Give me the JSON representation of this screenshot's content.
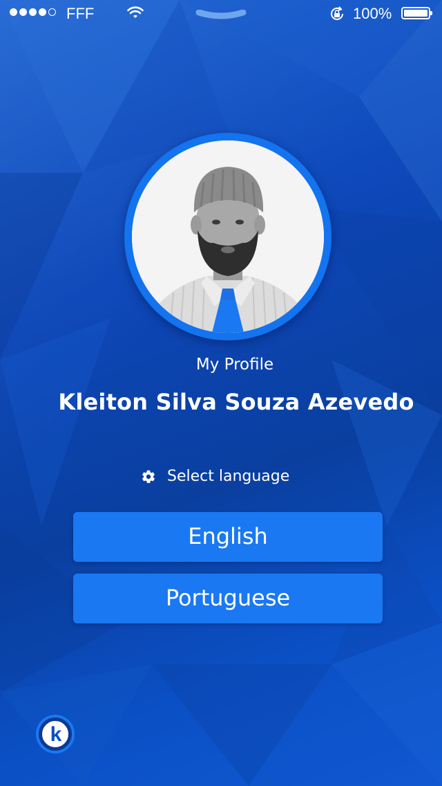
{
  "status_bar": {
    "carrier": "FFF",
    "battery_percent": "100%",
    "signal_bars_filled": 4,
    "signal_bars_total": 5,
    "icons": [
      "wifi-icon",
      "orientation-lock-icon",
      "battery-icon",
      "control-center-handle-icon"
    ]
  },
  "profile": {
    "title": "My Profile",
    "name": "Kleiton Silva Souza Azevedo",
    "avatar_icon": "profile-photo"
  },
  "language": {
    "label": "Select language",
    "icon": "gear-icon",
    "options": [
      "English",
      "Portuguese"
    ]
  },
  "footer": {
    "logo_letter": "k",
    "logo_icon": "k-logo-icon"
  },
  "colors": {
    "background": "#0d47b8",
    "button": "#1a78f2",
    "avatar_ring": "#1473ee",
    "text": "#ffffff"
  }
}
